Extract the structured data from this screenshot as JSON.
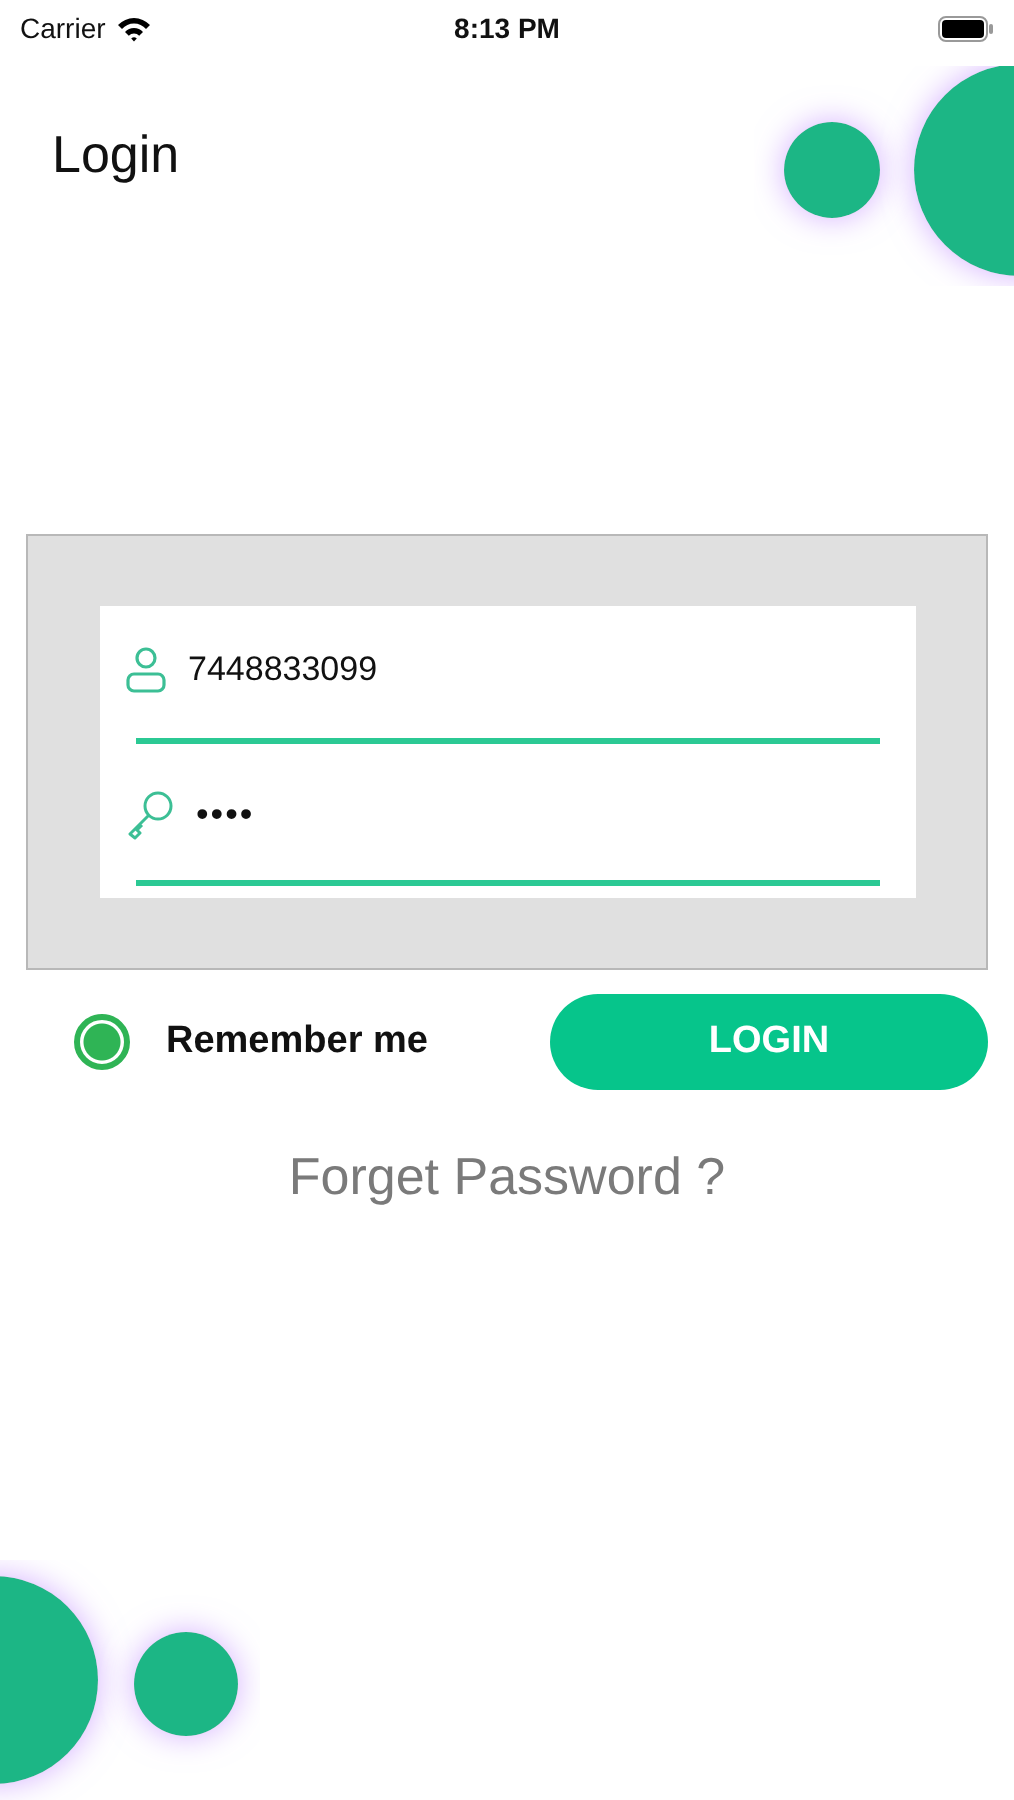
{
  "status_bar": {
    "carrier": "Carrier",
    "time": "8:13 PM"
  },
  "title": "Login",
  "fields": [
    {
      "kind": "user",
      "value": "7448833099"
    },
    {
      "kind": "password",
      "value": "••••"
    }
  ],
  "remember": {
    "label": "Remember me",
    "checked": true
  },
  "login_button": "LOGIN",
  "forgot_link": "Forget Password ?"
}
